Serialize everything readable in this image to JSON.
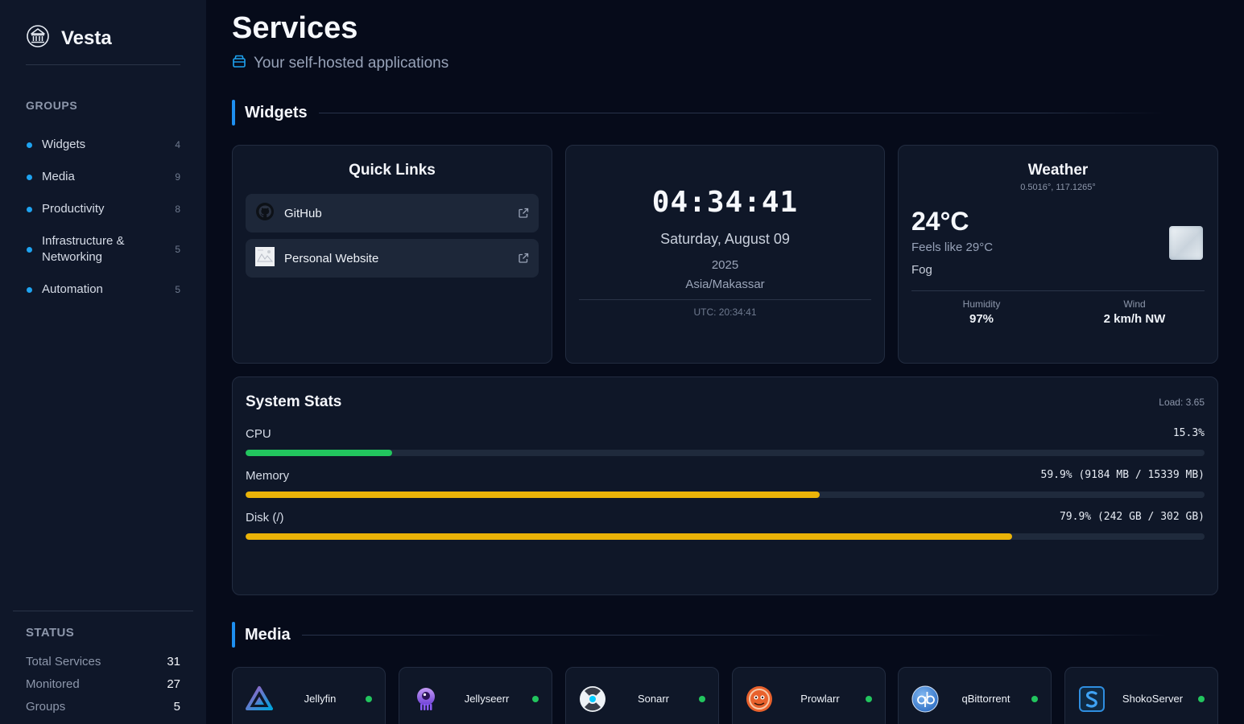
{
  "app": {
    "name": "Vesta"
  },
  "sidebar": {
    "groups_title": "GROUPS",
    "groups": [
      {
        "label": "Widgets",
        "count": "4"
      },
      {
        "label": "Media",
        "count": "9"
      },
      {
        "label": "Productivity",
        "count": "8"
      },
      {
        "label": "Infrastructure & Networking",
        "count": "5"
      },
      {
        "label": "Automation",
        "count": "5"
      }
    ],
    "status_title": "STATUS",
    "status": [
      {
        "label": "Total Services",
        "value": "31"
      },
      {
        "label": "Monitored",
        "value": "27"
      },
      {
        "label": "Groups",
        "value": "5"
      }
    ]
  },
  "page": {
    "title": "Services",
    "subtitle": "Your self-hosted applications",
    "icon": "box-icon"
  },
  "sections": {
    "widgets": "Widgets",
    "media": "Media"
  },
  "quick_links": {
    "title": "Quick Links",
    "items": [
      {
        "label": "GitHub",
        "icon": "github-icon"
      },
      {
        "label": "Personal Website",
        "icon": "website-thumbnail"
      }
    ]
  },
  "clock": {
    "time": "04:34:41",
    "date": "Saturday, August 09",
    "year": "2025",
    "timezone": "Asia/Makassar",
    "utc": "UTC: 20:34:41"
  },
  "weather": {
    "title": "Weather",
    "coords": "0.5016°, 117.1265°",
    "temp": "24°C",
    "feels": "Feels like 29°C",
    "condition": "Fog",
    "icon": "fog-icon",
    "humidity_label": "Humidity",
    "humidity": "97%",
    "wind_label": "Wind",
    "wind": "2 km/h NW"
  },
  "system_stats": {
    "title": "System Stats",
    "load": "Load: 3.65",
    "rows": [
      {
        "label": "CPU",
        "value": "15.3%",
        "percent": 15.3,
        "color": "#22c55e"
      },
      {
        "label": "Memory",
        "value": "59.9% (9184 MB / 15339 MB)",
        "percent": 59.9,
        "color": "#eab308"
      },
      {
        "label": "Disk (/)",
        "value": "79.9% (242 GB / 302 GB)",
        "percent": 79.9,
        "color": "#eab308"
      }
    ]
  },
  "media_services": [
    {
      "name": "Jellyfin",
      "icon": "jellyfin-icon",
      "status": "online"
    },
    {
      "name": "Jellyseerr",
      "icon": "jellyseerr-icon",
      "status": "online"
    },
    {
      "name": "Sonarr",
      "icon": "sonarr-icon",
      "status": "online"
    },
    {
      "name": "Prowlarr",
      "icon": "prowlarr-icon",
      "status": "online"
    },
    {
      "name": "qBittorrent",
      "icon": "qbittorrent-icon",
      "status": "online"
    },
    {
      "name": "ShokoServer",
      "icon": "shokoserver-icon",
      "status": "online"
    }
  ],
  "colors": {
    "accent": "#1e8ff0",
    "online": "#22c55e",
    "warning": "#eab308",
    "background": "#060b1a",
    "card": "#0f1728"
  }
}
